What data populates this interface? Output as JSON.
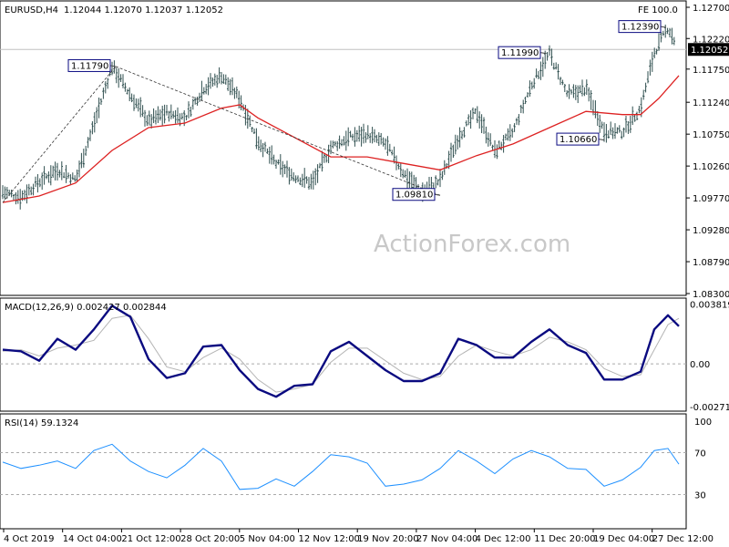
{
  "header": {
    "symbol": "EURUSD,H4",
    "ohlc": "1.12044 1.12070 1.12037 1.12052",
    "fe": "FE 100.0"
  },
  "watermark": "ActionForex.com",
  "colors": {
    "price": "#2f4f4f",
    "ma": "#dd2222",
    "macd": "#0a0a80",
    "signal": "#b4b4b4",
    "rsi": "#1e90ff",
    "box_border": "#0a0a80"
  },
  "chart_data": [
    {
      "type": "ohlc",
      "panel": "price",
      "ylim": [
        1.083,
        1.127
      ],
      "y_ticks": [
        "1.12700",
        "1.12220",
        "1.11750",
        "1.11240",
        "1.10750",
        "1.10260",
        "1.09770",
        "1.09280",
        "1.08790",
        "1.08300"
      ],
      "current_price": "1.12052",
      "x_ticks": [
        "4 Oct 2019",
        "14 Oct 04:00",
        "21 Oct 12:00",
        "28 Oct 20:00",
        "5 Nov 04:00",
        "12 Nov 12:00",
        "19 Nov 20:00",
        "27 Nov 04:00",
        "4 Dec 12:00",
        "11 Dec 20:00",
        "19 Dec 04:00",
        "27 Dec 12:00"
      ],
      "series": [
        {
          "kind": "price",
          "points": [
            [
              0,
              1.0986
            ],
            [
              20,
              1.0978
            ],
            [
              40,
              1.1002
            ],
            [
              60,
              1.1021
            ],
            [
              80,
              1.1005
            ],
            [
              100,
              1.109
            ],
            [
              120,
              1.1179
            ],
            [
              140,
              1.1135
            ],
            [
              160,
              1.1095
            ],
            [
              180,
              1.1108
            ],
            [
              200,
              1.11
            ],
            [
              220,
              1.1145
            ],
            [
              240,
              1.1165
            ],
            [
              260,
              1.113
            ],
            [
              280,
              1.1065
            ],
            [
              300,
              1.103
            ],
            [
              320,
              1.101
            ],
            [
              340,
              1.1
            ],
            [
              360,
              1.1055
            ],
            [
              380,
              1.107
            ],
            [
              400,
              1.1075
            ],
            [
              420,
              1.106
            ],
            [
              440,
              1.1015
            ],
            [
              460,
              1.0985
            ],
            [
              480,
              1.1004
            ],
            [
              500,
              1.107
            ],
            [
              520,
              1.111
            ],
            [
              540,
              1.1048
            ],
            [
              560,
              1.1078
            ],
            [
              580,
              1.115
            ],
            [
              600,
              1.1199
            ],
            [
              620,
              1.1135
            ],
            [
              640,
              1.1145
            ],
            [
              660,
              1.108
            ],
            [
              680,
              1.1078
            ],
            [
              700,
              1.1115
            ],
            [
              715,
              1.12
            ],
            [
              730,
              1.1239
            ],
            [
              742,
              1.1205
            ]
          ]
        },
        {
          "kind": "ma",
          "points": [
            [
              0,
              1.097
            ],
            [
              40,
              1.098
            ],
            [
              80,
              1.1
            ],
            [
              120,
              1.105
            ],
            [
              160,
              1.1085
            ],
            [
              200,
              1.1092
            ],
            [
              240,
              1.1115
            ],
            [
              260,
              1.112
            ],
            [
              280,
              1.11
            ],
            [
              320,
              1.107
            ],
            [
              360,
              1.104
            ],
            [
              400,
              1.104
            ],
            [
              440,
              1.103
            ],
            [
              480,
              1.102
            ],
            [
              520,
              1.1042
            ],
            [
              560,
              1.106
            ],
            [
              600,
              1.1085
            ],
            [
              640,
              1.111
            ],
            [
              680,
              1.1105
            ],
            [
              700,
              1.1105
            ],
            [
              720,
              1.113
            ],
            [
              742,
              1.1165
            ]
          ]
        }
      ],
      "annotations": [
        {
          "text": "1.11790",
          "ax": 124,
          "ay": 1.1179
        },
        {
          "text": "1.09810",
          "ax": 480,
          "ay": 1.0981
        },
        {
          "text": "1.11990",
          "ax": 596,
          "ay": 1.1199
        },
        {
          "text": "1.10660",
          "ax": 660,
          "ay": 1.1066
        },
        {
          "text": "1.12390",
          "ax": 728,
          "ay": 1.1239
        }
      ],
      "trendlines": [
        {
          "style": "dashed",
          "points": [
            [
              0,
              1.097
            ],
            [
              124,
              1.1179
            ]
          ]
        },
        {
          "style": "dashed",
          "points": [
            [
              124,
              1.1179
            ],
            [
              480,
              1.0981
            ]
          ]
        }
      ]
    },
    {
      "type": "line",
      "panel": "macd",
      "title": "MACD(12,26,9) 0.002427 0.002844",
      "ylim": [
        -0.0029,
        0.0039
      ],
      "y_ticks": [
        "0.003819",
        "0.00",
        "-0.002713"
      ],
      "series": [
        {
          "name": "macd",
          "points": [
            [
              0,
              0.0009
            ],
            [
              20,
              0.0008
            ],
            [
              40,
              0.0002
            ],
            [
              60,
              0.0016
            ],
            [
              80,
              0.0009
            ],
            [
              100,
              0.0022
            ],
            [
              120,
              0.0037
            ],
            [
              140,
              0.003
            ],
            [
              160,
              0.0003
            ],
            [
              180,
              -0.0009
            ],
            [
              200,
              -0.0006
            ],
            [
              220,
              0.0011
            ],
            [
              240,
              0.0012
            ],
            [
              260,
              -0.0004
            ],
            [
              280,
              -0.0016
            ],
            [
              300,
              -0.0021
            ],
            [
              320,
              -0.0014
            ],
            [
              340,
              -0.0013
            ],
            [
              360,
              0.0008
            ],
            [
              380,
              0.0014
            ],
            [
              400,
              0.0005
            ],
            [
              420,
              -0.0004
            ],
            [
              440,
              -0.0011
            ],
            [
              460,
              -0.0011
            ],
            [
              480,
              -0.0006
            ],
            [
              500,
              0.0016
            ],
            [
              520,
              0.0012
            ],
            [
              540,
              0.0004
            ],
            [
              560,
              0.0004
            ],
            [
              580,
              0.0014
            ],
            [
              600,
              0.0022
            ],
            [
              620,
              0.0012
            ],
            [
              640,
              0.0007
            ],
            [
              660,
              -0.001
            ],
            [
              680,
              -0.001
            ],
            [
              700,
              -0.0005
            ],
            [
              715,
              0.0022
            ],
            [
              730,
              0.0031
            ],
            [
              742,
              0.0024
            ]
          ]
        },
        {
          "name": "signal",
          "points": [
            [
              0,
              0.0008
            ],
            [
              20,
              0.0009
            ],
            [
              40,
              0.0005
            ],
            [
              60,
              0.001
            ],
            [
              80,
              0.0012
            ],
            [
              100,
              0.0015
            ],
            [
              120,
              0.0029
            ],
            [
              140,
              0.0031
            ],
            [
              160,
              0.0016
            ],
            [
              180,
              -0.0002
            ],
            [
              200,
              -0.0005
            ],
            [
              220,
              0.0004
            ],
            [
              240,
              0.001
            ],
            [
              260,
              0.0003
            ],
            [
              280,
              -0.001
            ],
            [
              300,
              -0.0018
            ],
            [
              320,
              -0.0016
            ],
            [
              340,
              -0.0013
            ],
            [
              360,
              0.0001
            ],
            [
              380,
              0.001
            ],
            [
              400,
              0.001
            ],
            [
              420,
              0.0002
            ],
            [
              440,
              -0.0006
            ],
            [
              460,
              -0.001
            ],
            [
              480,
              -0.0008
            ],
            [
              500,
              0.0005
            ],
            [
              520,
              0.0012
            ],
            [
              540,
              0.0008
            ],
            [
              560,
              0.0005
            ],
            [
              580,
              0.0009
            ],
            [
              600,
              0.0017
            ],
            [
              620,
              0.0014
            ],
            [
              640,
              0.0009
            ],
            [
              660,
              -0.0003
            ],
            [
              680,
              -0.0008
            ],
            [
              700,
              -0.0007
            ],
            [
              715,
              0.0009
            ],
            [
              730,
              0.0025
            ],
            [
              742,
              0.0029
            ]
          ]
        }
      ]
    },
    {
      "type": "line",
      "panel": "rsi",
      "title": "RSI(14) 59.1324",
      "ylim": [
        0,
        100
      ],
      "y_ticks": [
        "100",
        "70",
        "30"
      ],
      "series": [
        {
          "name": "rsi",
          "points": [
            [
              0,
              61
            ],
            [
              20,
              55
            ],
            [
              40,
              58
            ],
            [
              60,
              62
            ],
            [
              80,
              55
            ],
            [
              100,
              72
            ],
            [
              120,
              78
            ],
            [
              140,
              62
            ],
            [
              160,
              52
            ],
            [
              180,
              46
            ],
            [
              200,
              58
            ],
            [
              220,
              74
            ],
            [
              240,
              62
            ],
            [
              260,
              35
            ],
            [
              280,
              36
            ],
            [
              300,
              45
            ],
            [
              320,
              38
            ],
            [
              340,
              52
            ],
            [
              360,
              68
            ],
            [
              380,
              66
            ],
            [
              400,
              60
            ],
            [
              420,
              38
            ],
            [
              440,
              40
            ],
            [
              460,
              44
            ],
            [
              480,
              55
            ],
            [
              500,
              72
            ],
            [
              520,
              62
            ],
            [
              540,
              50
            ],
            [
              560,
              64
            ],
            [
              580,
              72
            ],
            [
              600,
              66
            ],
            [
              620,
              55
            ],
            [
              640,
              54
            ],
            [
              660,
              38
            ],
            [
              680,
              44
            ],
            [
              700,
              56
            ],
            [
              715,
              72
            ],
            [
              730,
              74
            ],
            [
              742,
              59
            ]
          ]
        }
      ]
    }
  ]
}
